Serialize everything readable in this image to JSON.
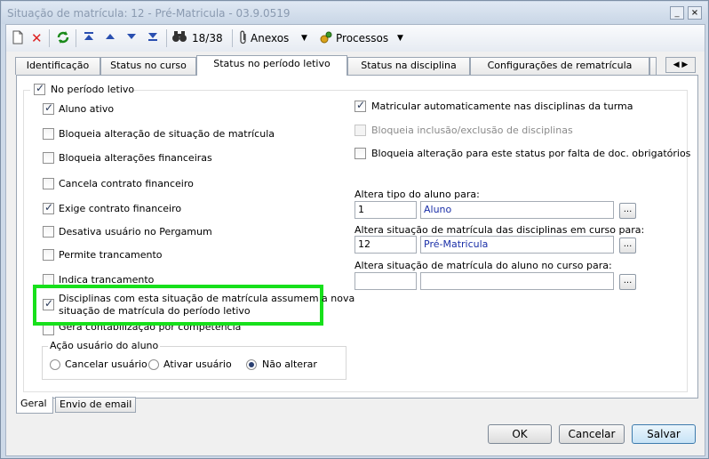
{
  "window": {
    "title": "Situação de matrícula: 12 - Pré-Matricula - 03.9.0519",
    "minimize": "_",
    "close": "×"
  },
  "toolbar": {
    "nav_counter": "18/38",
    "anexos": "Anexos",
    "processos": "Processos"
  },
  "tabs": [
    {
      "label": "Identificação"
    },
    {
      "label": "Status no curso"
    },
    {
      "label": "Status no período letivo"
    },
    {
      "label": "Status na disciplina"
    },
    {
      "label": "Configurações de rematrícula"
    }
  ],
  "group": {
    "label": "No período letivo",
    "checked": true
  },
  "left_checkboxes": [
    {
      "label": "Aluno ativo",
      "checked": true
    },
    {
      "label": "Bloqueia alteração de situação de matrícula",
      "checked": false
    },
    {
      "label": "Bloqueia alterações financeiras",
      "checked": false
    },
    {
      "label": "Cancela contrato financeiro",
      "checked": false
    },
    {
      "label": "Exige contrato financeiro",
      "checked": true
    },
    {
      "label": "Desativa usuário no Pergamum",
      "checked": false
    },
    {
      "label": "Permite trancamento",
      "checked": false
    },
    {
      "label": "Indica trancamento",
      "checked": false
    }
  ],
  "highlighted": {
    "line1": "Disciplinas com esta situação de matrícula assumem a nova",
    "line2": "situação de matrícula do período letivo",
    "checked": true
  },
  "gera": {
    "label": "Gera contabilização por competência",
    "checked": false
  },
  "acao": {
    "label": "Ação usuário do aluno",
    "options": [
      {
        "label": "Cancelar usuário",
        "selected": false
      },
      {
        "label": "Ativar usuário",
        "selected": false
      },
      {
        "label": "Não alterar",
        "selected": true
      }
    ]
  },
  "right_checkboxes": [
    {
      "label": "Matricular automaticamente nas disciplinas da turma",
      "checked": true,
      "disabled": false
    },
    {
      "label": "Bloqueia inclusão/exclusão de disciplinas",
      "checked": false,
      "disabled": true
    },
    {
      "label": "Bloqueia alteração para este status por falta de doc. obrigatórios",
      "checked": false,
      "disabled": false
    }
  ],
  "fields": [
    {
      "label": "Altera tipo do aluno para:",
      "code": "1",
      "desc": "Aluno"
    },
    {
      "label": "Altera situação de matrícula das disciplinas em curso para:",
      "code": "12",
      "desc": "Pré-Matricula"
    },
    {
      "label": "Altera situação de matrícula do aluno no curso para:",
      "code": "",
      "desc": ""
    }
  ],
  "lookup_label": "...",
  "bottom_tabs": [
    {
      "label": "Geral"
    },
    {
      "label": "Envio de email"
    }
  ],
  "buttons": {
    "ok": "OK",
    "cancel": "Cancelar",
    "save": "Salvar"
  }
}
